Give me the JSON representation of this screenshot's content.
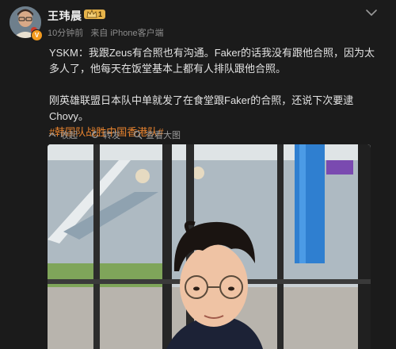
{
  "author": {
    "name": "王玮晨",
    "level": "1",
    "verified_mark": "V",
    "avatar_icon": "avatar-photo",
    "crown_icon": "crown-icon"
  },
  "meta": {
    "time": "10分钟前",
    "source": "来自 iPhone客户端"
  },
  "post": {
    "line1": "YSKM：我跟Zeus有合照也有沟通。Faker的话我没有跟他合照，因为太多人了，他每天在饭堂基本上都有人排队跟他合照。",
    "line2": "刚英雄联盟日本队中单就发了在食堂跟Faker的合照，还说下次要逮Chovy。",
    "hashtag": "#韩国队战胜中国香港队#"
  },
  "toolbar": {
    "collect_label": "收起",
    "repost_label": "转发",
    "view_image_label": "查看大图"
  },
  "colors": {
    "background": "#1b1b1b",
    "hashtag": "#e8832e",
    "meta": "#8c8c8c",
    "verified": "#f39a1e"
  }
}
